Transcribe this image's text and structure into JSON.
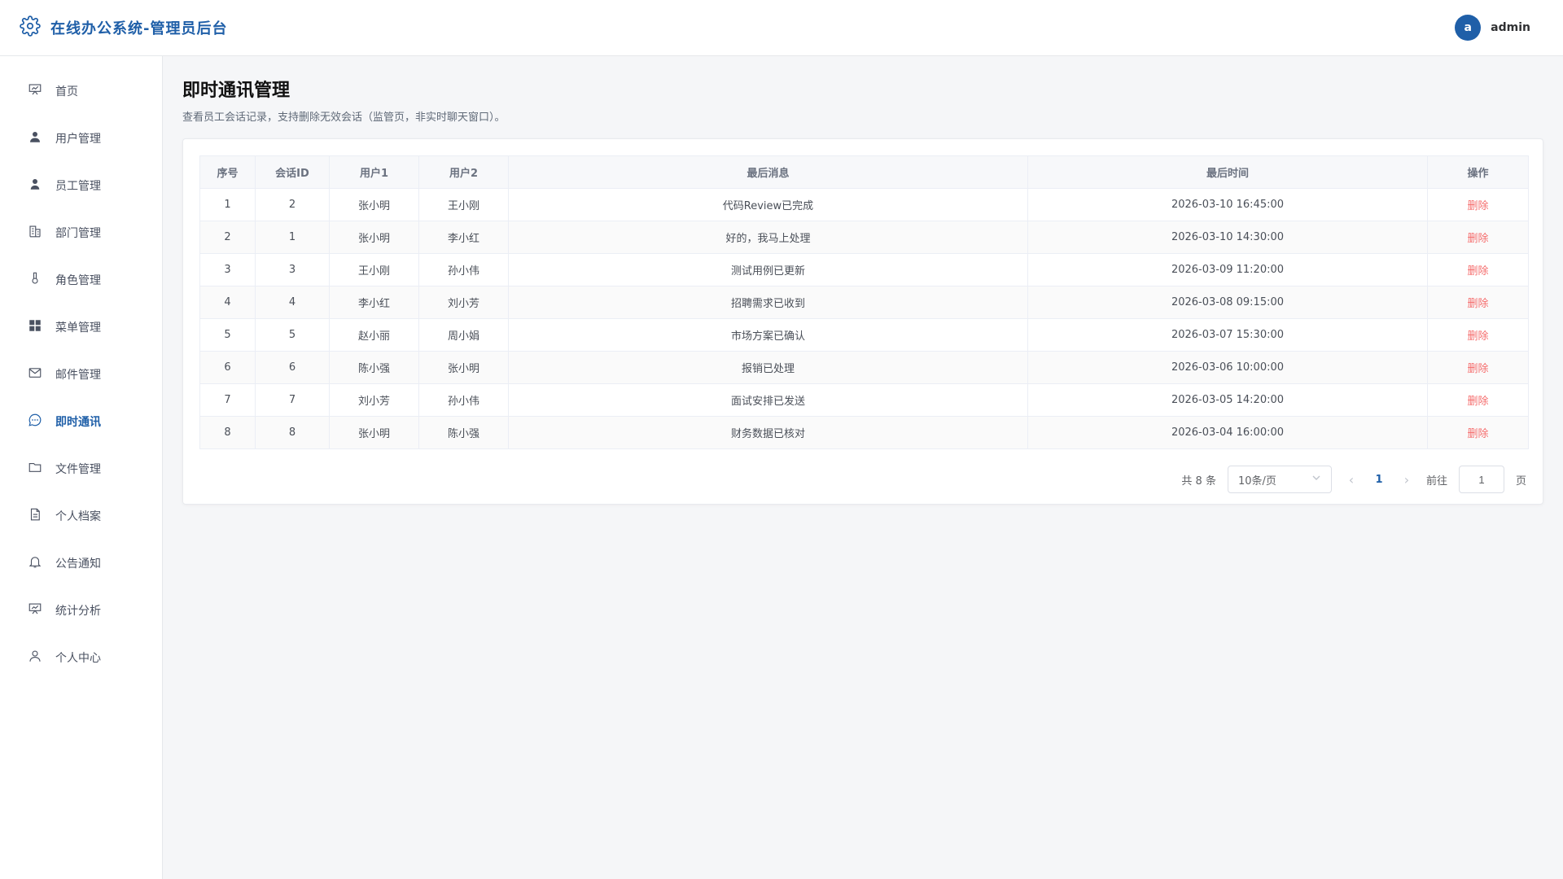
{
  "app": {
    "title": "在线办公系统-管理员后台",
    "user_initial": "a",
    "username": "admin",
    "accent": "#1f5fa8"
  },
  "sidebar": {
    "items": [
      {
        "label": "首页",
        "icon": "dashboard-icon",
        "active": false
      },
      {
        "label": "用户管理",
        "icon": "user-icon",
        "active": false
      },
      {
        "label": "员工管理",
        "icon": "employee-icon",
        "active": false
      },
      {
        "label": "部门管理",
        "icon": "building-icon",
        "active": false
      },
      {
        "label": "角色管理",
        "icon": "role-icon",
        "active": false
      },
      {
        "label": "菜单管理",
        "icon": "grid-icon",
        "active": false
      },
      {
        "label": "邮件管理",
        "icon": "mail-icon",
        "active": false
      },
      {
        "label": "即时通讯",
        "icon": "chat-icon",
        "active": true
      },
      {
        "label": "文件管理",
        "icon": "folder-icon",
        "active": false
      },
      {
        "label": "个人档案",
        "icon": "document-icon",
        "active": false
      },
      {
        "label": "公告通知",
        "icon": "bell-icon",
        "active": false
      },
      {
        "label": "统计分析",
        "icon": "chart-icon",
        "active": false
      },
      {
        "label": "个人中心",
        "icon": "person-icon",
        "active": false
      }
    ]
  },
  "page": {
    "title": "即时通讯管理",
    "description": "查看员工会话记录，支持删除无效会话（监管页，非实时聊天窗口）。"
  },
  "table": {
    "headers": [
      "序号",
      "会话ID",
      "用户1",
      "用户2",
      "最后消息",
      "最后时间",
      "操作"
    ],
    "rows": [
      [
        "1",
        "2",
        "张小明",
        "王小刚",
        "代码Review已完成",
        "2026-03-10 16:45:00",
        "删除"
      ],
      [
        "2",
        "1",
        "张小明",
        "李小红",
        "好的，我马上处理",
        "2026-03-10 14:30:00",
        "删除"
      ],
      [
        "3",
        "3",
        "王小刚",
        "孙小伟",
        "测试用例已更新",
        "2026-03-09 11:20:00",
        "删除"
      ],
      [
        "4",
        "4",
        "李小红",
        "刘小芳",
        "招聘需求已收到",
        "2026-03-08 09:15:00",
        "删除"
      ],
      [
        "5",
        "5",
        "赵小丽",
        "周小娟",
        "市场方案已确认",
        "2026-03-07 15:30:00",
        "删除"
      ],
      [
        "6",
        "6",
        "陈小强",
        "张小明",
        "报销已处理",
        "2026-03-06 10:00:00",
        "删除"
      ],
      [
        "7",
        "7",
        "刘小芳",
        "孙小伟",
        "面试安排已发送",
        "2026-03-05 14:20:00",
        "删除"
      ],
      [
        "8",
        "8",
        "张小明",
        "陈小强",
        "财务数据已核对",
        "2026-03-04 16:00:00",
        "删除"
      ]
    ]
  },
  "pagination": {
    "total": "共 8 条",
    "page_size": "10条/页",
    "current_page": "1",
    "goto_label": "前往",
    "goto_value": "1",
    "page_suffix": "页"
  }
}
